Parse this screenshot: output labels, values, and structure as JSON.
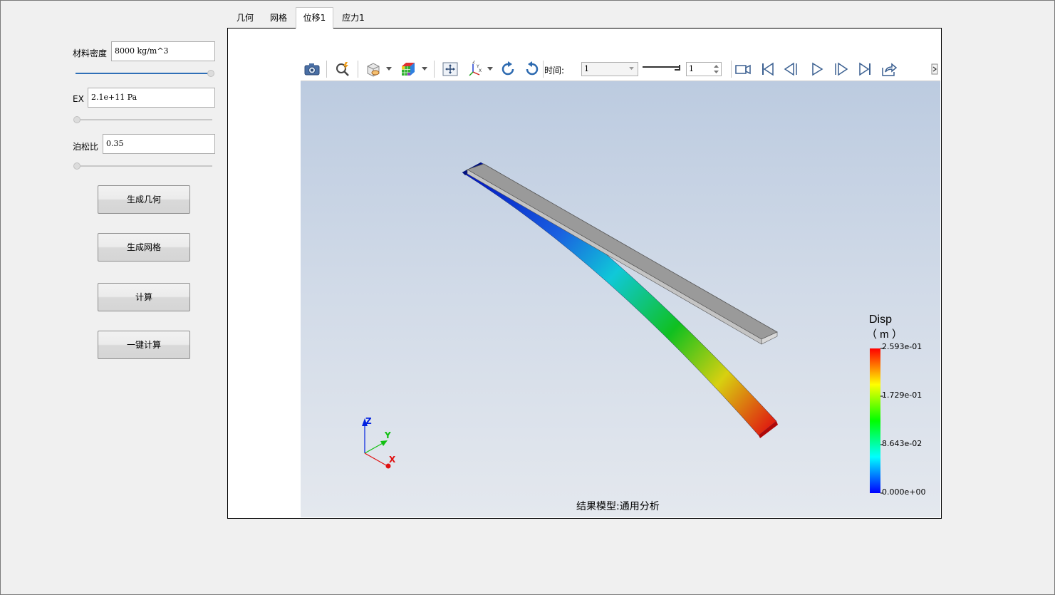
{
  "left_panel": {
    "density": {
      "label": "材料密度",
      "value": "8000 kg/m^3",
      "slider_value": 1.0
    },
    "ex": {
      "label": "EX",
      "value": "2.1e+11 Pa",
      "slider_value": 0.0
    },
    "poisson": {
      "label": "泊松比",
      "value": "0.35",
      "slider_value": 0.0
    },
    "buttons": {
      "gen_geometry": "生成几何",
      "gen_mesh": "生成网格",
      "compute": "计算",
      "one_click": "一键计算"
    }
  },
  "tabs": [
    {
      "label": "几何",
      "active": false
    },
    {
      "label": "网格",
      "active": false
    },
    {
      "label": "位移1",
      "active": true
    },
    {
      "label": "应力1",
      "active": false
    }
  ],
  "toolbar": {
    "time_label": "时间:",
    "time_value": "1",
    "step_value": "1",
    "icons": [
      "camera-icon",
      "zoom-icon",
      "display-mode-icon",
      "colormap-cube-icon",
      "fit-view-icon",
      "axes-icon",
      "rotate-cw-icon",
      "rotate-ccw-icon",
      "record-icon",
      "first-frame-icon",
      "prev-frame-icon",
      "play-icon",
      "next-frame-icon",
      "last-frame-icon",
      "export-icon",
      "collapse-icon"
    ]
  },
  "viewport": {
    "caption": "结果模型:通用分析",
    "legend": {
      "title": "Disp",
      "unit": "（ m ）",
      "labels": [
        "2.593e-01",
        "1.729e-01",
        "8.643e-02",
        "0.000e+00"
      ],
      "colors": [
        "#0000ff",
        "#00ffff",
        "#00ff00",
        "#ffff00",
        "#ff0000"
      ]
    },
    "axes": {
      "z": "Z",
      "y": "Y",
      "x": "X"
    }
  }
}
